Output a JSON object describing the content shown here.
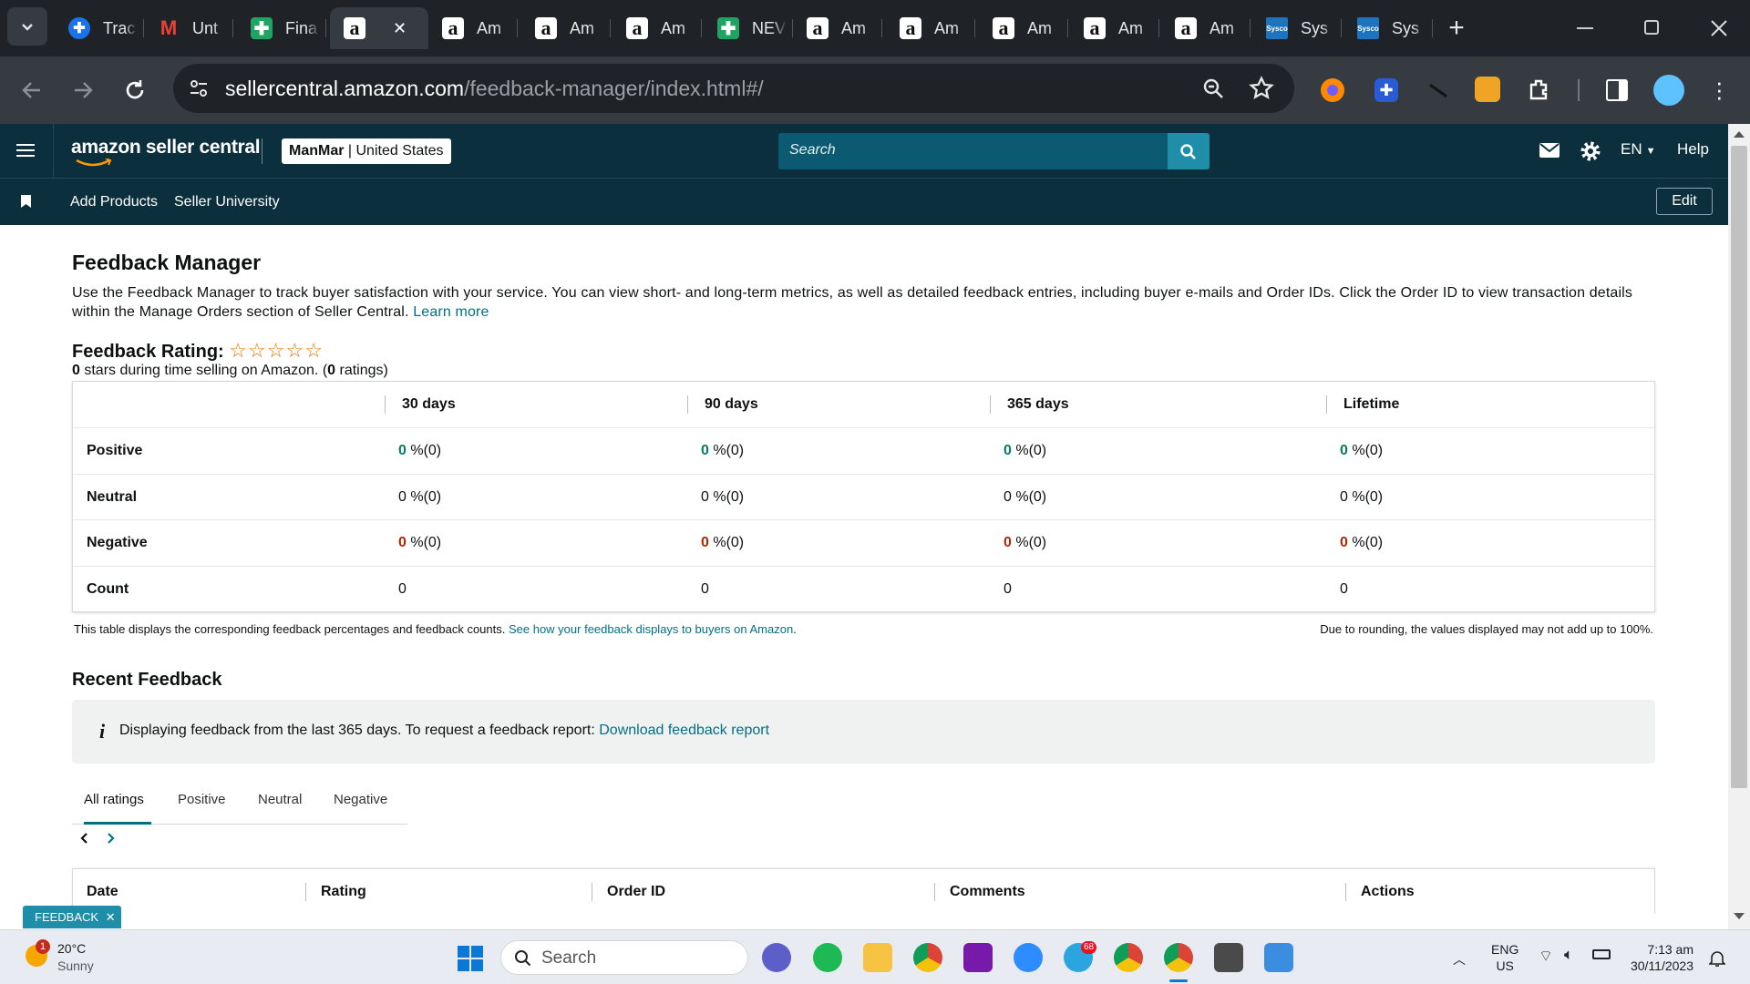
{
  "browser": {
    "tabs": [
      {
        "icon": "tracker-favicon-icon",
        "label": "Trac",
        "kind": "blue"
      },
      {
        "icon": "gmail-icon",
        "label": "Unt",
        "kind": "gmail"
      },
      {
        "icon": "sheets-icon",
        "label": "Fina",
        "kind": "sheet"
      },
      {
        "icon": "amazon-icon",
        "label": "",
        "kind": "amz",
        "active": true
      },
      {
        "icon": "amazon-icon",
        "label": "Am",
        "kind": "amz"
      },
      {
        "icon": "amazon-icon",
        "label": "Am",
        "kind": "amz"
      },
      {
        "icon": "amazon-icon",
        "label": "Am",
        "kind": "amz"
      },
      {
        "icon": "sheets-icon",
        "label": "NEV",
        "kind": "sheet"
      },
      {
        "icon": "amazon-icon",
        "label": "Am",
        "kind": "amz"
      },
      {
        "icon": "amazon-icon",
        "label": "Am",
        "kind": "amz"
      },
      {
        "icon": "amazon-icon",
        "label": "Am",
        "kind": "amz"
      },
      {
        "icon": "amazon-icon",
        "label": "Am",
        "kind": "amz"
      },
      {
        "icon": "amazon-icon",
        "label": "Am",
        "kind": "amz"
      },
      {
        "icon": "sysco-icon",
        "label": "Sys",
        "kind": "sysco"
      },
      {
        "icon": "sysco-icon",
        "label": "Sys",
        "kind": "sysco"
      }
    ],
    "url_host": "sellercentral.amazon.com",
    "url_path": "/feedback-manager/index.html#/"
  },
  "header": {
    "logo_text": "amazon seller central",
    "store_name": "ManMar",
    "store_region": " | United States",
    "search_placeholder": "Search",
    "language": "EN",
    "help": "Help"
  },
  "nav": {
    "items": [
      "Add Products",
      "Seller University"
    ],
    "edit": "Edit"
  },
  "page": {
    "title": "Feedback Manager",
    "description": "Use the Feedback Manager to track buyer satisfaction with your service. You can view short- and long-term metrics, as well as detailed feedback entries, including buyer e-mails and Order IDs. Click the Order ID to view transaction details within the Manage Orders section of Seller Central.",
    "learn_more": "Learn more",
    "rating_label": "Feedback Rating:",
    "stars_filled": 0,
    "stars_total": 5,
    "rating_value": "0",
    "rating_mid": " stars during time selling on Amazon. (",
    "rating_count": "0",
    "rating_end": " ratings)"
  },
  "feedback_table": {
    "columns": [
      "30 days",
      "90 days",
      "365 days",
      "Lifetime"
    ],
    "rows": [
      {
        "label": "Positive",
        "values": [
          {
            "n": "0",
            "s": " %(0)"
          },
          {
            "n": "0",
            "s": " %(0)"
          },
          {
            "n": "0",
            "s": " %(0)"
          },
          {
            "n": "0",
            "s": " %(0)"
          }
        ],
        "tone": "green"
      },
      {
        "label": "Neutral",
        "values": [
          {
            "n": "0",
            "s": " %(0)"
          },
          {
            "n": "0",
            "s": " %(0)"
          },
          {
            "n": "0",
            "s": " %(0)"
          },
          {
            "n": "0",
            "s": " %(0)"
          }
        ],
        "tone": "plain"
      },
      {
        "label": "Negative",
        "values": [
          {
            "n": "0",
            "s": " %(0)"
          },
          {
            "n": "0",
            "s": " %(0)"
          },
          {
            "n": "0",
            "s": " %(0)"
          },
          {
            "n": "0",
            "s": " %(0)"
          }
        ],
        "tone": "red"
      },
      {
        "label": "Count",
        "values": [
          {
            "n": "0",
            "s": ""
          },
          {
            "n": "0",
            "s": ""
          },
          {
            "n": "0",
            "s": ""
          },
          {
            "n": "0",
            "s": ""
          }
        ],
        "tone": "count"
      }
    ],
    "footnote": "This table displays the corresponding feedback percentages and feedback counts.",
    "footnote_link": "See how your feedback displays to buyers on Amazon",
    "rounding_note": "Due to rounding, the values displayed may not add up to 100%."
  },
  "recent": {
    "title": "Recent Feedback",
    "info": "Displaying feedback from the last 365 days. To request a feedback report:",
    "info_link": "Download feedback report",
    "tabs": [
      "All ratings",
      "Positive",
      "Neutral",
      "Negative"
    ],
    "columns": [
      "Date",
      "Rating",
      "Order ID",
      "Comments",
      "Actions"
    ]
  },
  "feedback_tag": "FEEDBACK",
  "taskbar": {
    "weather_temp": "20°C",
    "weather_desc": "Sunny",
    "weather_badge": "1",
    "search_placeholder": "Search",
    "telegram_badge": "68",
    "lang_top": "ENG",
    "lang_bottom": "US",
    "time": "7:13 am",
    "date": "30/11/2023"
  },
  "colors": {
    "seller_header": "#0b2f3d",
    "search_bg": "#0b5a72",
    "search_btn": "#1f8ea8",
    "link": "#007185",
    "positive": "#067d62",
    "negative": "#b12704",
    "star": "#e77600"
  }
}
